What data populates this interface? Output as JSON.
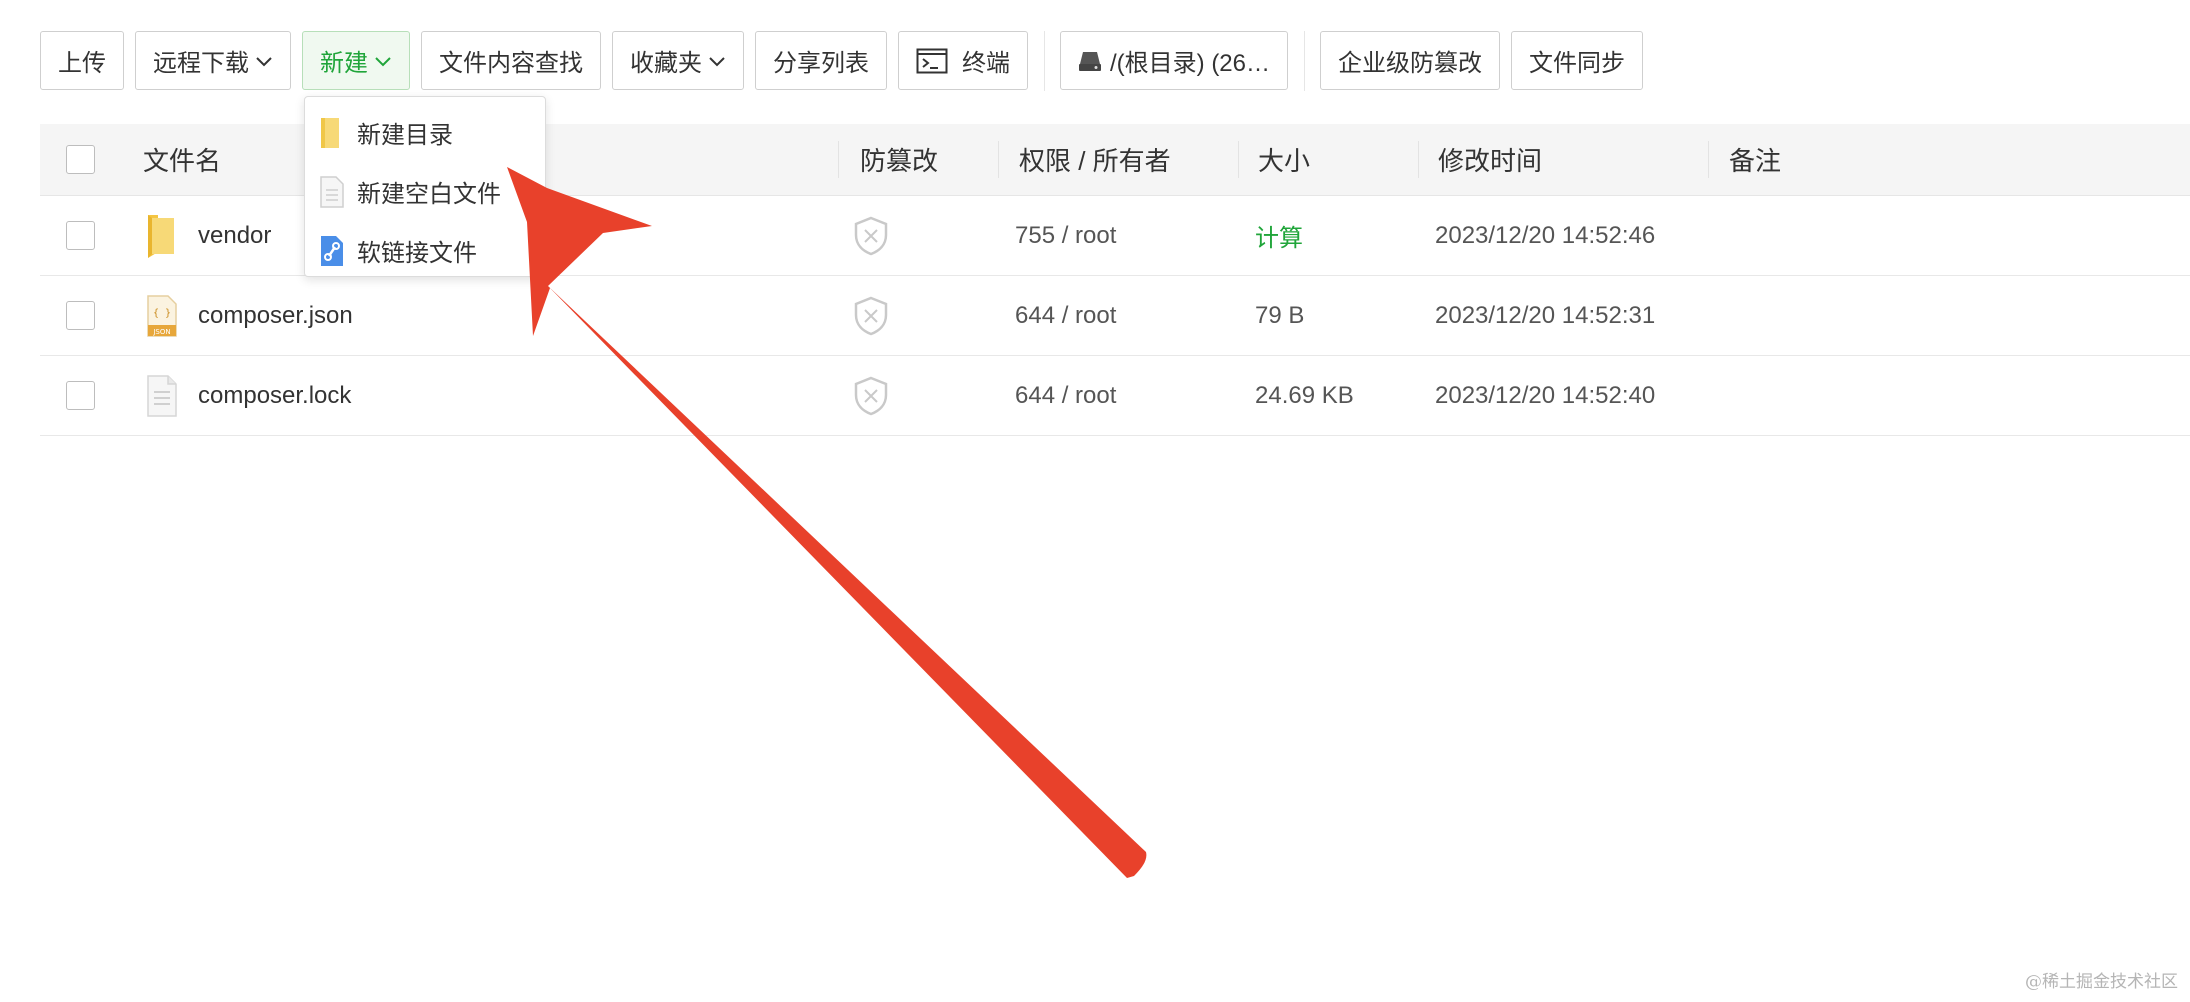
{
  "toolbar": {
    "upload": "上传",
    "remote_download": "远程下载",
    "new": "新建",
    "content_search": "文件内容查找",
    "favorites": "收藏夹",
    "share_list": "分享列表",
    "terminal": "终端",
    "disk": "/(根目录) (26…",
    "tamper_proof": "企业级防篡改",
    "file_sync": "文件同步"
  },
  "dropdown": {
    "items": [
      {
        "label": "新建目录",
        "icon": "folder-icon"
      },
      {
        "label": "新建空白文件",
        "icon": "blank-file-icon"
      },
      {
        "label": "软链接文件",
        "icon": "link-file-icon"
      }
    ]
  },
  "table": {
    "headers": {
      "name": "文件名",
      "tamper": "防篡改",
      "perm": "权限 / 所有者",
      "size": "大小",
      "mtime": "修改时间",
      "remark": "备注"
    },
    "rows": [
      {
        "name": "vendor",
        "icon": "folder-icon",
        "perm": "755 / root",
        "size": "计算",
        "mtime": "2023/12/20 14:52:46",
        "remark": ""
      },
      {
        "name": "composer.json",
        "icon": "json-file-icon",
        "perm": "644 / root",
        "size": "79 B",
        "mtime": "2023/12/20 14:52:31",
        "remark": ""
      },
      {
        "name": "composer.lock",
        "icon": "file-icon",
        "perm": "644 / root",
        "size": "24.69 KB",
        "mtime": "2023/12/20 14:52:40",
        "remark": ""
      }
    ]
  },
  "colors": {
    "accent": "#20a53a",
    "arrow": "#e8412b"
  },
  "watermark": "@稀土掘金技术社区"
}
